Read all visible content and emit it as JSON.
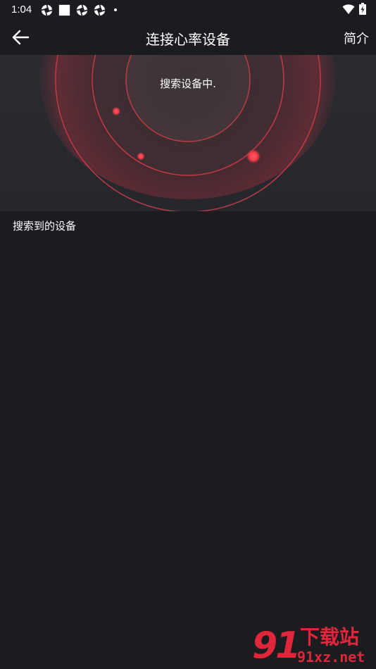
{
  "status_bar": {
    "time": "1:04"
  },
  "toolbar": {
    "title": "连接心率设备",
    "intro_label": "简介"
  },
  "radar": {
    "status_text": "搜索设备中.",
    "accent_color": "#e84452"
  },
  "device_section": {
    "title": "搜索到的设备"
  },
  "watermark": {
    "logo_number": "91",
    "logo_text": "下载站",
    "url": "91xz.net"
  }
}
